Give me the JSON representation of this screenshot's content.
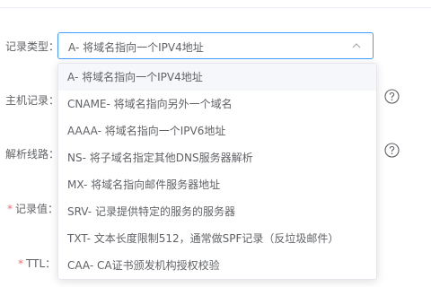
{
  "form": {
    "record_type_label": "记录类型：",
    "host_label": "主机记录：",
    "line_label": "解析线路：",
    "value_label": "记录值：",
    "ttl_label": "TTL：",
    "required_mark": "*",
    "record_type_selected": "A- 将域名指向一个IPV4地址"
  },
  "dropdown": {
    "options": [
      {
        "label": "A- 将域名指向一个IPV4地址",
        "selected": true
      },
      {
        "label": "CNAME- 将域名指向另外一个域名"
      },
      {
        "label": "AAAA- 将域名指向一个IPV6地址"
      },
      {
        "label": "NS- 将子域名指定其他DNS服务器解析"
      },
      {
        "label": "MX- 将域名指向邮件服务器地址"
      },
      {
        "label": "SRV- 记录提供特定的服务的服务器"
      },
      {
        "label": "TXT- 文本长度限制512，通常做SPF记录（反垃圾邮件）"
      },
      {
        "label": "CAA- CA证书颁发机构授权校验"
      }
    ]
  },
  "icons": {
    "select_arrow": "chevron-up-icon",
    "help": "question-circle-icon"
  },
  "colors": {
    "focus_border": "#409eff",
    "required": "#f56c6c",
    "hover_bg": "#f5f7fa",
    "text": "#606266"
  }
}
